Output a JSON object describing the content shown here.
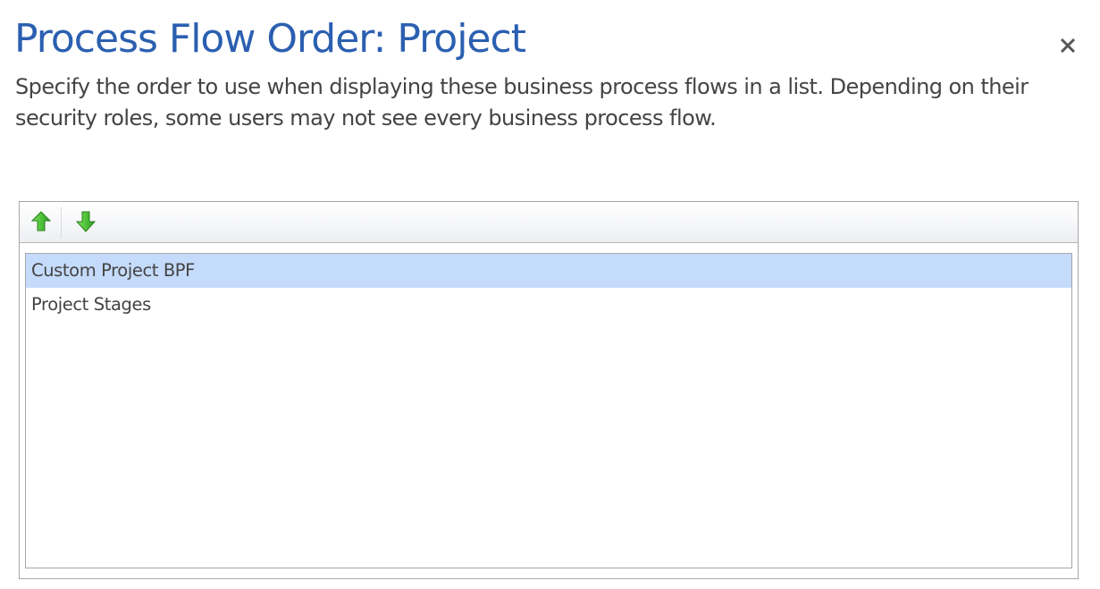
{
  "dialog": {
    "title": "Process Flow Order: Project",
    "description": "Specify the order to use when displaying these business process flows in a list. Depending on their security roles, some users may not see every business process flow.",
    "close_icon": "close-icon"
  },
  "toolbar": {
    "move_up_icon": "arrow-up-icon",
    "move_down_icon": "arrow-down-icon"
  },
  "process_flows": [
    {
      "label": "Custom Project BPF",
      "selected": true
    },
    {
      "label": "Project Stages",
      "selected": false
    }
  ],
  "colors": {
    "title": "#2b5fb0",
    "selected_row": "#c5dbfb",
    "arrow_fill": "#56c23f"
  }
}
